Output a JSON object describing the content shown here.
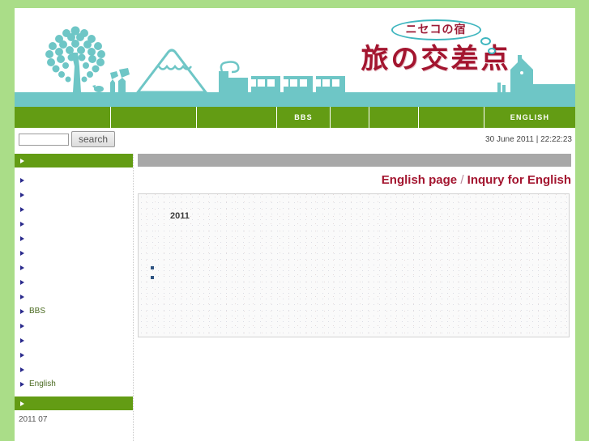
{
  "site": {
    "bubble_text": "ニセコの宿",
    "main_title": "旅の交差点"
  },
  "nav": {
    "items": [
      {
        "label": "",
        "width": 119
      },
      {
        "label": "",
        "width": 106
      },
      {
        "label": "",
        "width": 99
      },
      {
        "label": "BBS",
        "width": 66
      },
      {
        "label": "",
        "width": 48
      },
      {
        "label": "",
        "width": 61
      },
      {
        "label": "",
        "width": 81
      },
      {
        "label": "ENGLISH",
        "width": 112
      }
    ]
  },
  "toolbar": {
    "search_value": "",
    "search_placeholder": "",
    "search_label": "search",
    "datetime": "30 June 2011 | 22:22:23"
  },
  "sidebar": {
    "top_header_label": "",
    "items": [
      {
        "label": ""
      },
      {
        "label": ""
      },
      {
        "label": ""
      },
      {
        "label": ""
      },
      {
        "label": ""
      },
      {
        "label": ""
      },
      {
        "label": ""
      },
      {
        "label": ""
      },
      {
        "label": ""
      },
      {
        "label": "BBS"
      },
      {
        "label": ""
      },
      {
        "label": ""
      },
      {
        "label": ""
      },
      {
        "label": ""
      },
      {
        "label": "English"
      }
    ],
    "bottom_header_label": "",
    "archive_date": "2011 07"
  },
  "main": {
    "breadcrumb_first": "English page",
    "breadcrumb_separator": "/",
    "breadcrumb_second": "Inqury for English",
    "content_heading": "2011"
  },
  "colors": {
    "page_background": "#aadd88",
    "nav_green": "#639c14",
    "logo_teal": "#6ec6c6",
    "title_red": "#a3152f",
    "gray_bar": "#a8a8a8",
    "bullet_blue": "#2f5481"
  }
}
